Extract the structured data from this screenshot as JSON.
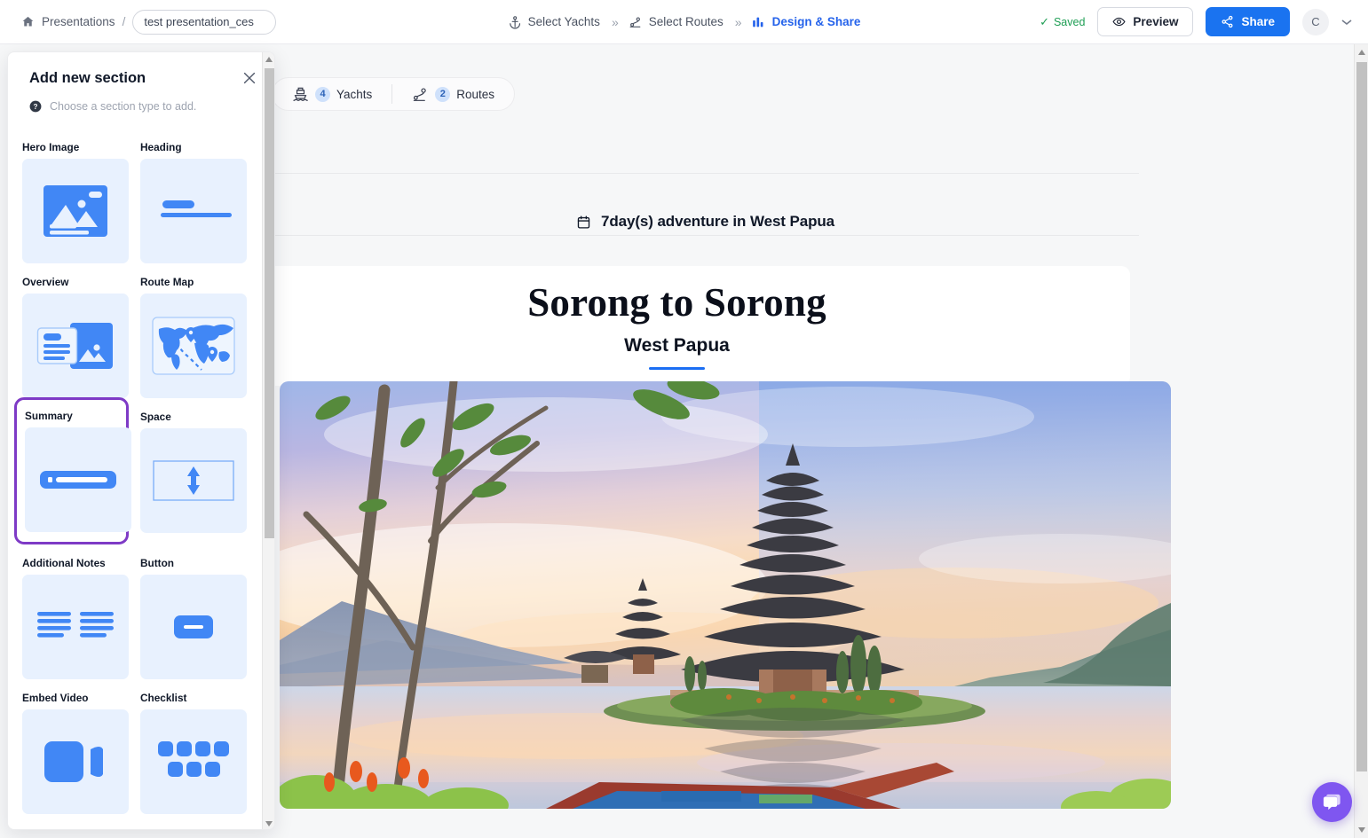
{
  "topbar": {
    "home_icon": "home-icon",
    "breadcrumb_root": "Presentations",
    "breadcrumb_separator": "/",
    "doc_title_value": "test presentation_ces",
    "doc_title_placeholder": "Presentation name",
    "steps": [
      {
        "label": "Select Yachts",
        "icon": "anchor-icon",
        "active": false
      },
      {
        "label": "Select Routes",
        "icon": "route-pin-icon",
        "active": false
      },
      {
        "label": "Design & Share",
        "icon": "chart-bars-icon",
        "active": true
      }
    ],
    "step_separator": "»",
    "saved_label": "Saved",
    "saved_check": "✓",
    "saved_color": "#1e9e54",
    "preview_label": "Preview",
    "preview_icon": "eye-icon",
    "share_label": "Share",
    "share_icon": "share-nodes-icon",
    "share_color": "#1a73f0",
    "avatar_initial": "C",
    "avatar_chevron": "⌄"
  },
  "panel": {
    "title": "Add new section",
    "close_icon": "close-icon",
    "hint_icon": "help-circle-icon",
    "hint": "Choose a section type to add.",
    "selected_section": "Summary",
    "selection_color": "#7e3ac6",
    "sections": [
      {
        "label": "Hero Image",
        "icon": "image-placeholder-icon",
        "selected": false
      },
      {
        "label": "Heading",
        "icon": "heading-lines-icon",
        "selected": false
      },
      {
        "label": "Overview",
        "icon": "overview-card-icon",
        "selected": false
      },
      {
        "label": "Route Map",
        "icon": "world-map-pins-icon",
        "selected": false
      },
      {
        "label": "Summary",
        "icon": "summary-bar-icon",
        "selected": true
      },
      {
        "label": "Space",
        "icon": "vertical-arrows-icon",
        "selected": false
      },
      {
        "label": "Additional Notes",
        "icon": "text-columns-icon",
        "selected": false
      },
      {
        "label": "Button",
        "icon": "button-pill-icon",
        "selected": false
      },
      {
        "label": "Embed Video",
        "icon": "video-camera-icon",
        "selected": false
      },
      {
        "label": "Checklist",
        "icon": "checklist-blocks-icon",
        "selected": false
      }
    ]
  },
  "canvas": {
    "pill": {
      "yachts_count": "4",
      "yachts_label": "Yachts",
      "yachts_icon": "yacht-icon",
      "routes_count": "2",
      "routes_label": "Routes",
      "routes_icon": "route-pin-icon"
    },
    "adventure": {
      "icon": "calendar-icon",
      "text": "7day(s) adventure in West Papua"
    },
    "hero": {
      "title": "Sorong to Sorong",
      "subtitle": "West Papua",
      "rule_color": "#1b6ef3",
      "photo_alt": "lake-temple-sunrise-photo"
    }
  },
  "chat": {
    "icon": "chat-bubbles-icon",
    "color": "#7f56f0"
  },
  "scrollbars": {
    "page_up": "scroll-up-arrow",
    "page_down": "scroll-down-arrow",
    "panel_up": "scroll-up-arrow",
    "panel_down": "scroll-down-arrow"
  }
}
